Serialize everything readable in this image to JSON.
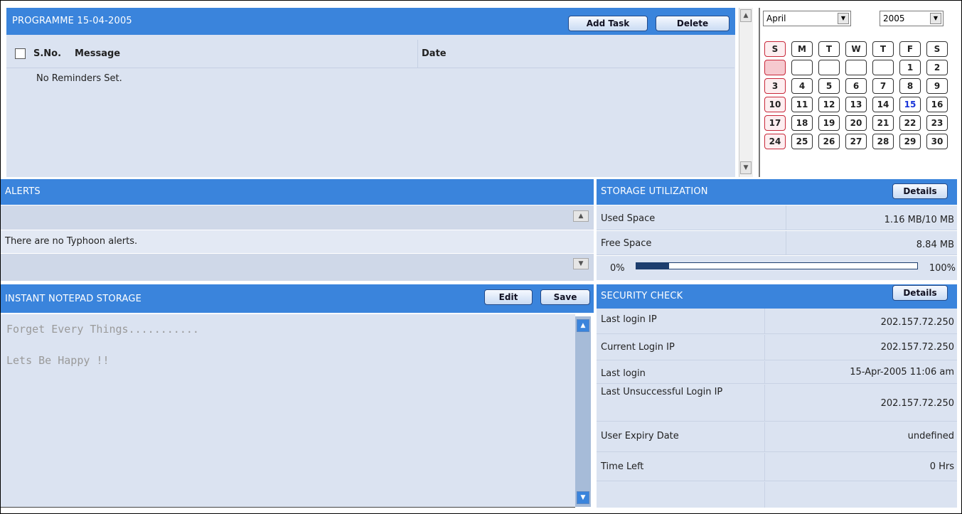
{
  "programme": {
    "title": "PROGRAMME 15-04-2005",
    "add_task_label": "Add Task",
    "delete_label": "Delete",
    "columns": [
      "S.No.",
      "Message",
      "Date"
    ],
    "empty_message": "No Reminders Set."
  },
  "calendar": {
    "month": "April",
    "year": "2005",
    "weekdays": [
      "S",
      "M",
      "T",
      "W",
      "T",
      "F",
      "S"
    ],
    "today": "15",
    "weeks": [
      [
        "",
        "",
        "",
        "",
        "",
        "1",
        "2"
      ],
      [
        "3",
        "4",
        "5",
        "6",
        "7",
        "8",
        "9"
      ],
      [
        "10",
        "11",
        "12",
        "13",
        "14",
        "15",
        "16"
      ],
      [
        "17",
        "18",
        "19",
        "20",
        "21",
        "22",
        "23"
      ],
      [
        "24",
        "25",
        "26",
        "27",
        "28",
        "29",
        "30"
      ]
    ]
  },
  "alerts": {
    "title": "ALERTS",
    "message": "There are no Typhoon alerts."
  },
  "storage": {
    "title": "STORAGE UTILIZATION",
    "details_label": "Details",
    "used_label": "Used Space",
    "used_value": "1.16 MB/10 MB",
    "free_label": "Free Space",
    "free_value": "8.84 MB",
    "progress_min": "0%",
    "progress_max": "100%",
    "used_fraction": 0.116
  },
  "notepad": {
    "title": "INSTANT NOTEPAD STORAGE",
    "edit_label": "Edit",
    "save_label": "Save",
    "content": "Forget Every Things...........\n\nLets Be Happy !!"
  },
  "security": {
    "title": "SECURITY CHECK",
    "details_label": "Details",
    "rows": [
      {
        "label": "Last login IP",
        "value": "202.157.72.250"
      },
      {
        "label": "Current Login IP",
        "value": "202.157.72.250"
      },
      {
        "label": "Last login",
        "value": "15-Apr-2005 11:06 am"
      },
      {
        "label": "Last Unsuccessful Login IP",
        "value": "202.157.72.250"
      },
      {
        "label": "User Expiry Date",
        "value": "undefined"
      },
      {
        "label": "Time Left",
        "value": "0 Hrs"
      }
    ]
  },
  "colors": {
    "header_blue": "#3a84dc",
    "panel_bg": "#dbe3f1",
    "progress_fill": "#1d3e6e",
    "sunday_red": "#c8283a",
    "today_blue": "#1a35d8"
  },
  "icons": {
    "scroll_up": "scroll-up-icon",
    "scroll_down": "scroll-down-icon",
    "dropdown": "dropdown-arrow-icon"
  }
}
